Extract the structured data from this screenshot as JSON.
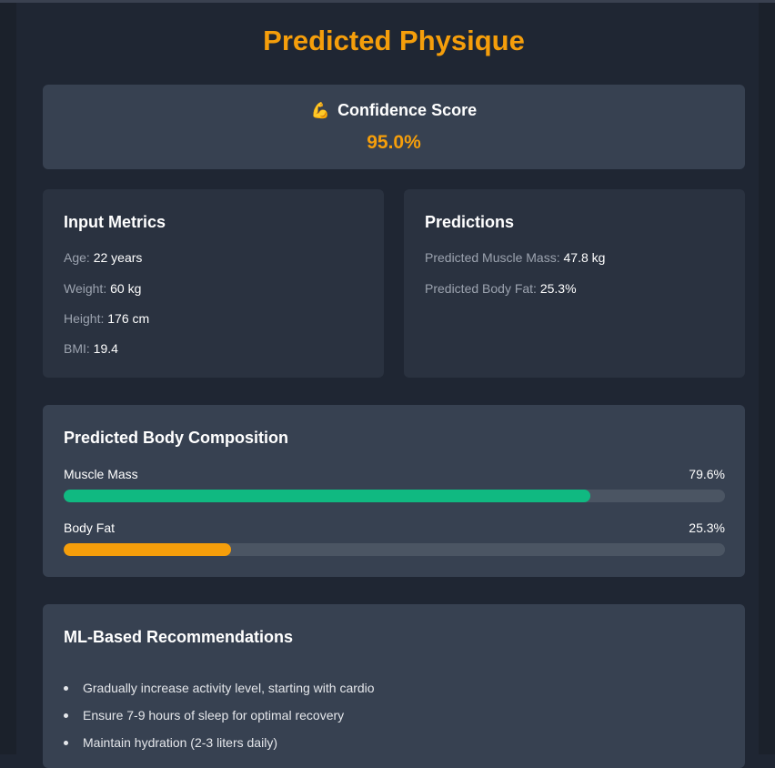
{
  "page": {
    "title": "Predicted Physique"
  },
  "confidence": {
    "icon": "flexed-biceps-icon",
    "icon_glyph": "💪",
    "heading": "Confidence Score",
    "value": "95.0%"
  },
  "input_metrics": {
    "heading": "Input Metrics",
    "items": [
      {
        "label": "Age:",
        "value": "22 years"
      },
      {
        "label": "Weight:",
        "value": "60 kg"
      },
      {
        "label": "Height:",
        "value": "176 cm"
      },
      {
        "label": "BMI:",
        "value": "19.4"
      }
    ]
  },
  "predictions": {
    "heading": "Predictions",
    "items": [
      {
        "label": "Predicted Muscle Mass:",
        "value": "47.8 kg"
      },
      {
        "label": "Predicted Body Fat:",
        "value": "25.3%"
      }
    ]
  },
  "composition": {
    "heading": "Predicted Body Composition",
    "bars": [
      {
        "label": "Muscle Mass",
        "percent_text": "79.6%",
        "fraction": 0.796,
        "color": "#10b981"
      },
      {
        "label": "Body Fat",
        "percent_text": "25.3%",
        "fraction": 0.253,
        "color": "#f59e0b"
      }
    ]
  },
  "recommendations": {
    "heading": "ML-Based Recommendations",
    "items": [
      "Gradually increase activity level, starting with cardio",
      "Ensure 7-9 hours of sleep for optimal recovery",
      "Maintain hydration (2-3 liters daily)"
    ]
  },
  "colors": {
    "accent": "#f59e0b",
    "background": "#1f2633",
    "card": "#374151",
    "card_dark": "#2a3240",
    "muscle": "#10b981",
    "track": "#4b5563"
  }
}
